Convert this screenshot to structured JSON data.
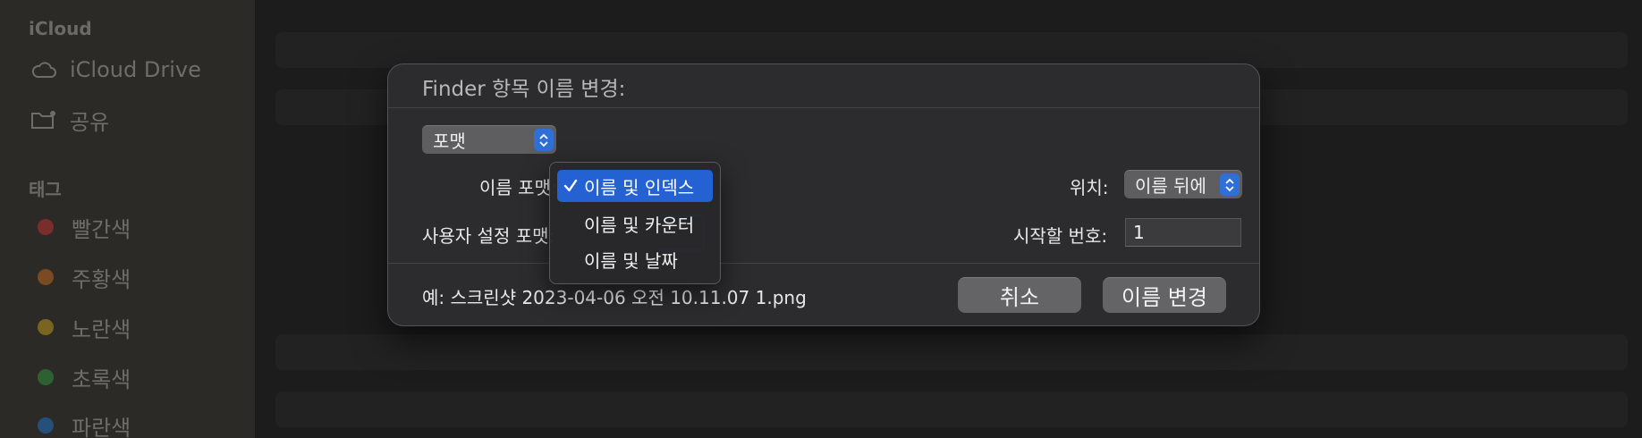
{
  "sidebar": {
    "icloud_header": "iCloud",
    "icloud_drive": "iCloud Drive",
    "shared": "공유",
    "tags_header": "태그",
    "tags": [
      {
        "label": "빨간색",
        "color": "#7a2e2b"
      },
      {
        "label": "주황색",
        "color": "#7a4a22"
      },
      {
        "label": "노란색",
        "color": "#7a6422"
      },
      {
        "label": "초록색",
        "color": "#2e6132"
      },
      {
        "label": "파란색",
        "color": "#24507a"
      }
    ]
  },
  "dialog": {
    "title": "Finder 항목 이름 변경:",
    "mode_popup": "포맷",
    "name_format_label": "이름 포맷:",
    "custom_format_label": "사용자 설정 포맷:",
    "position_label": "위치:",
    "position_value": "이름 뒤에",
    "start_number_label": "시작할 번호:",
    "start_number_value": "1",
    "example_text": "예: 스크린샷 2023-04-06 오전 10.11.07 1.png",
    "cancel_button": "취소",
    "rename_button": "이름 변경"
  },
  "menu": {
    "items": [
      {
        "label": "이름 및 인덱스",
        "selected": true
      },
      {
        "label": "이름 및 카운터",
        "selected": false
      },
      {
        "label": "이름 및 날짜",
        "selected": false
      }
    ]
  },
  "colors": {
    "accent": "#2461d3"
  }
}
